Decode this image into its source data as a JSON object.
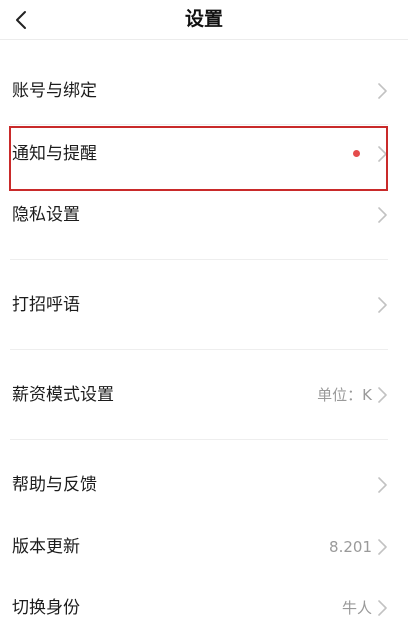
{
  "header": {
    "title": "设置",
    "back_icon": "chevron-left-icon"
  },
  "rows": [
    {
      "label": "账号与绑定",
      "value": ""
    },
    {
      "label": "通知与提醒",
      "value": "",
      "badge": "red-dot"
    },
    {
      "label": "隐私设置",
      "value": ""
    },
    {
      "label": "打招呼语",
      "value": ""
    },
    {
      "label": "薪资模式设置",
      "value": "单位：K"
    },
    {
      "label": "帮助与反馈",
      "value": ""
    },
    {
      "label": "版本更新",
      "value": "8.201"
    },
    {
      "label": "切换身份",
      "value": "牛人"
    }
  ],
  "colors": {
    "highlight": "#c92a2a",
    "badge": "#e44c4c",
    "value_text": "#9a9a9a"
  }
}
